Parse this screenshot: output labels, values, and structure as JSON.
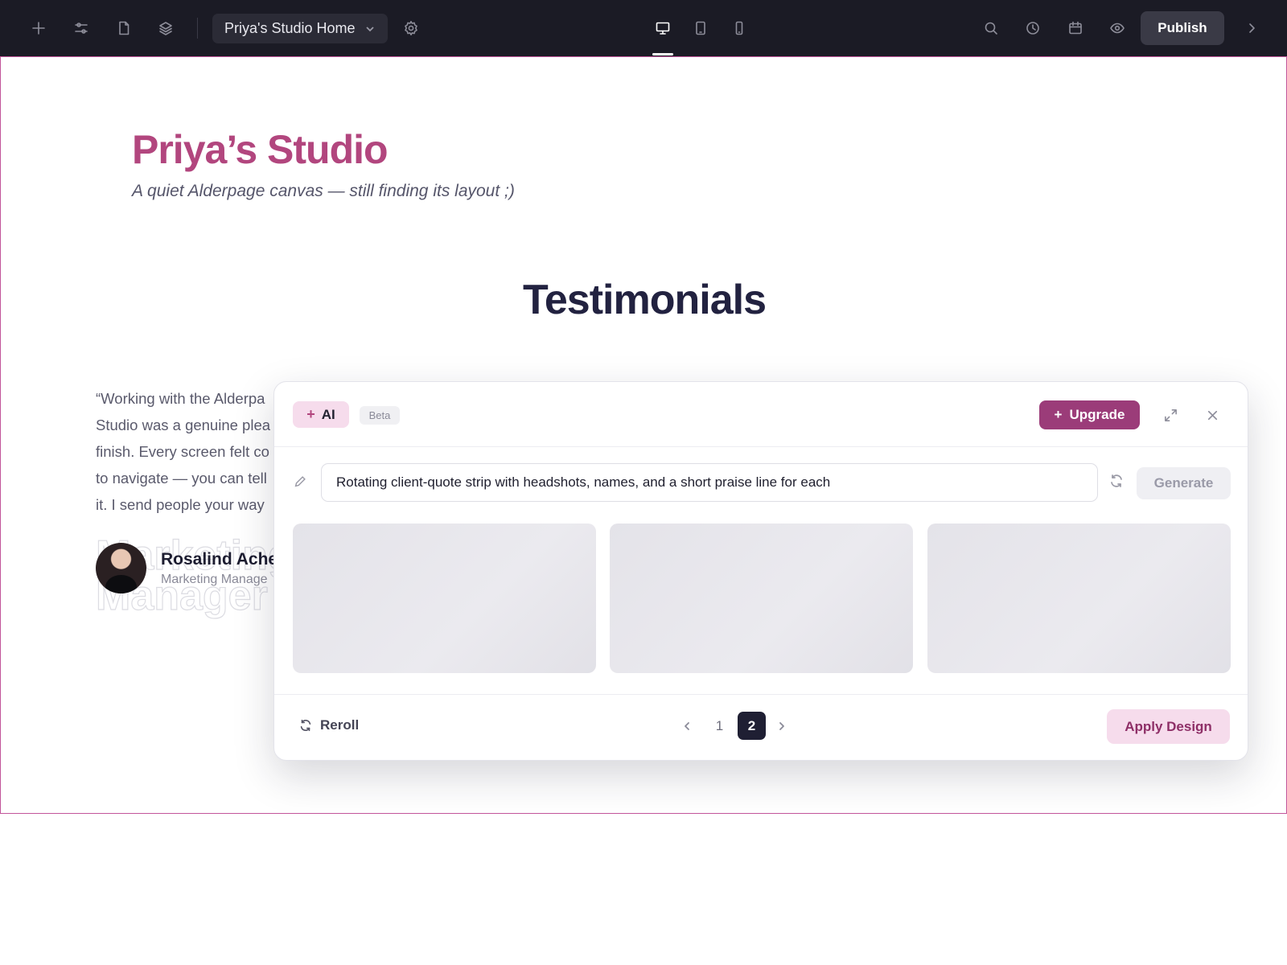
{
  "toolbar": {
    "page_selector": "Priya's Studio Home",
    "publish_label": "Publish",
    "left_icons": [
      "plus-icon",
      "sliders-icon",
      "page-icon",
      "layers-icon"
    ],
    "device_icons": [
      "desktop-icon",
      "tablet-icon",
      "mobile-icon"
    ],
    "active_device": "desktop",
    "right_icons": [
      "search-icon",
      "history-icon",
      "calendar-icon",
      "preview-eye-icon"
    ]
  },
  "canvas": {
    "site_title": "Priya’s Studio",
    "tagline": "A quiet Alderpage canvas — still finding its layout ;)",
    "section_title": "Testimonials",
    "quote_lines": [
      "“Working with the Alderpa",
      "Studio was a genuine plea",
      "finish. Every screen felt co",
      "to navigate — you can tell",
      "it. I send people your way"
    ],
    "ghost_text_1": "Marketing",
    "ghost_text_2": "Manager",
    "author_name": "Rosalind Achel",
    "author_role": "Marketing Manage"
  },
  "ai_dialog": {
    "ai_label": "AI",
    "beta_label": "Beta",
    "upgrade_label": "Upgrade",
    "prompt_value": "Rotating client-quote strip with headshots, names, and a short praise line for each",
    "generate_label": "Generate",
    "reroll_label": "Reroll",
    "pages": [
      "1",
      "2"
    ],
    "current_page": "2",
    "apply_label": "Apply Design"
  },
  "colors": {
    "brand": "#b2467e",
    "upgrade": "#9b3c79",
    "toolbar_bg": "#1b1b25",
    "heading": "#222240"
  }
}
